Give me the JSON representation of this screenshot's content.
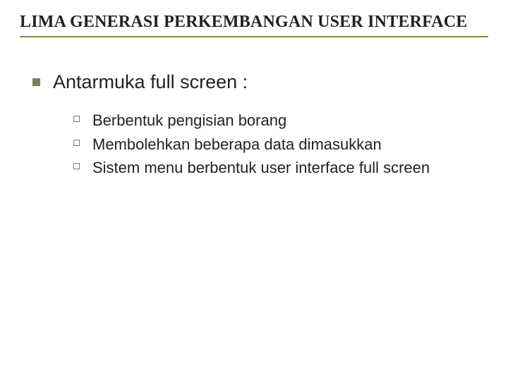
{
  "title": "LIMA GENERASI PERKEMBANGAN USER INTERFACE",
  "section": {
    "heading": "Antarmuka full screen :",
    "items": [
      "Berbentuk pengisian borang",
      "Membolehkan beberapa data dimasukkan",
      "Sistem menu berbentuk user interface full screen"
    ]
  }
}
